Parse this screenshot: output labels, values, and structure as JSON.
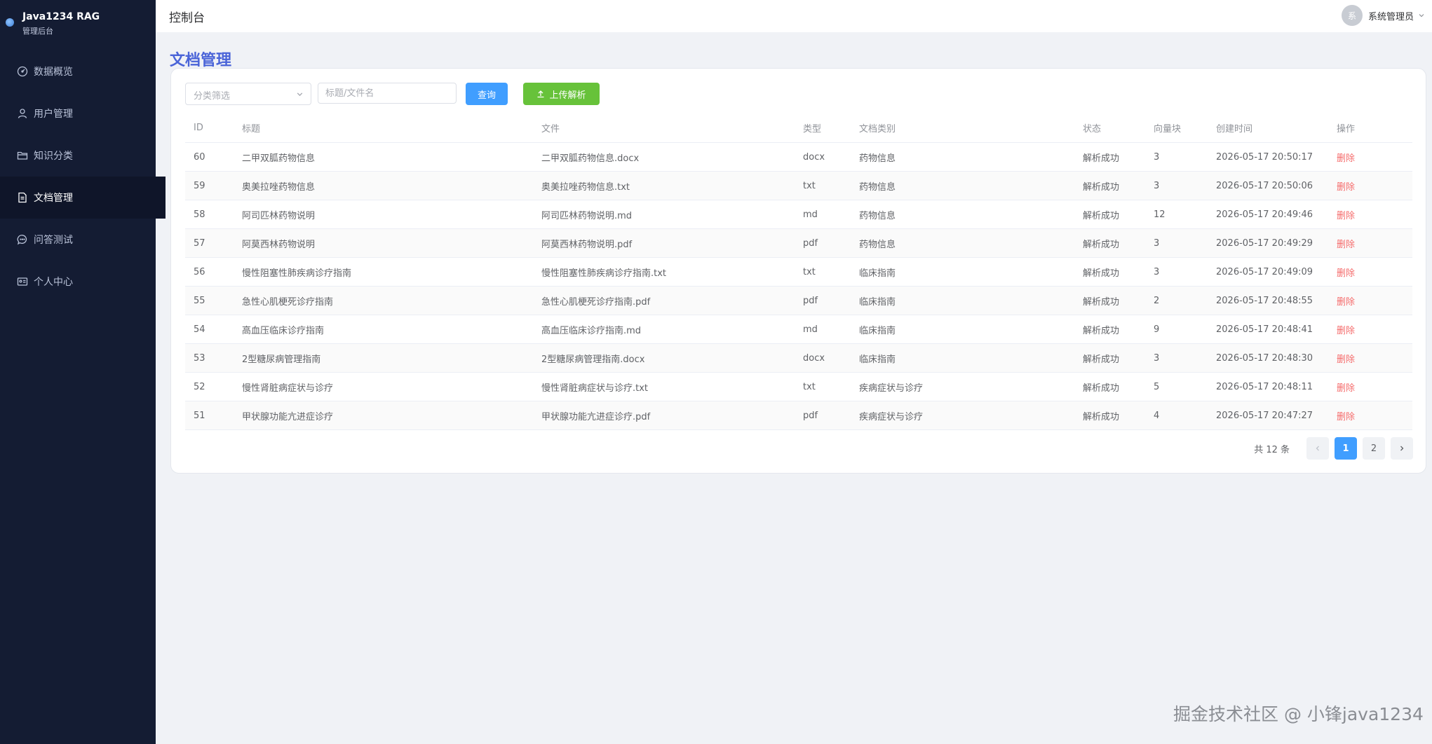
{
  "brand": {
    "title": "Java1234 RAG",
    "subtitle": "管理后台"
  },
  "sidebar": {
    "items": [
      {
        "label": "数据概览",
        "icon": "dashboard-icon"
      },
      {
        "label": "用户管理",
        "icon": "user-icon"
      },
      {
        "label": "知识分类",
        "icon": "folder-icon"
      },
      {
        "label": "文档管理",
        "icon": "document-icon",
        "active": true
      },
      {
        "label": "问答测试",
        "icon": "chat-icon"
      },
      {
        "label": "个人中心",
        "icon": "profile-card-icon"
      }
    ]
  },
  "header": {
    "title": "控制台",
    "avatar_text": "系",
    "user_name": "系统管理员"
  },
  "page": {
    "title": "文档管理"
  },
  "filters": {
    "category_placeholder": "分类筛选",
    "search_placeholder": "标题/文件名",
    "search_value": "",
    "query_label": "查询",
    "upload_label": "上传解析"
  },
  "table": {
    "columns": {
      "id": "ID",
      "title": "标题",
      "file": "文件",
      "type": "类型",
      "category": "文档类别",
      "status": "状态",
      "vectors": "向量块",
      "created": "创建时间",
      "op": "操作"
    },
    "rows": [
      {
        "id": "60",
        "title": "二甲双胍药物信息",
        "file": "二甲双胍药物信息.docx",
        "type": "docx",
        "category": "药物信息",
        "status": "解析成功",
        "vectors": "3",
        "created": "2026-05-17 20:50:17",
        "op": "删除"
      },
      {
        "id": "59",
        "title": "奥美拉唑药物信息",
        "file": "奥美拉唑药物信息.txt",
        "type": "txt",
        "category": "药物信息",
        "status": "解析成功",
        "vectors": "3",
        "created": "2026-05-17 20:50:06",
        "op": "删除"
      },
      {
        "id": "58",
        "title": "阿司匹林药物说明",
        "file": "阿司匹林药物说明.md",
        "type": "md",
        "category": "药物信息",
        "status": "解析成功",
        "vectors": "12",
        "created": "2026-05-17 20:49:46",
        "op": "删除"
      },
      {
        "id": "57",
        "title": "阿莫西林药物说明",
        "file": "阿莫西林药物说明.pdf",
        "type": "pdf",
        "category": "药物信息",
        "status": "解析成功",
        "vectors": "3",
        "created": "2026-05-17 20:49:29",
        "op": "删除"
      },
      {
        "id": "56",
        "title": "慢性阻塞性肺疾病诊疗指南",
        "file": "慢性阻塞性肺疾病诊疗指南.txt",
        "type": "txt",
        "category": "临床指南",
        "status": "解析成功",
        "vectors": "3",
        "created": "2026-05-17 20:49:09",
        "op": "删除"
      },
      {
        "id": "55",
        "title": "急性心肌梗死诊疗指南",
        "file": "急性心肌梗死诊疗指南.pdf",
        "type": "pdf",
        "category": "临床指南",
        "status": "解析成功",
        "vectors": "2",
        "created": "2026-05-17 20:48:55",
        "op": "删除"
      },
      {
        "id": "54",
        "title": "高血压临床诊疗指南",
        "file": "高血压临床诊疗指南.md",
        "type": "md",
        "category": "临床指南",
        "status": "解析成功",
        "vectors": "9",
        "created": "2026-05-17 20:48:41",
        "op": "删除"
      },
      {
        "id": "53",
        "title": "2型糖尿病管理指南",
        "file": "2型糖尿病管理指南.docx",
        "type": "docx",
        "category": "临床指南",
        "status": "解析成功",
        "vectors": "3",
        "created": "2026-05-17 20:48:30",
        "op": "删除"
      },
      {
        "id": "52",
        "title": "慢性肾脏病症状与诊疗",
        "file": "慢性肾脏病症状与诊疗.txt",
        "type": "txt",
        "category": "疾病症状与诊疗",
        "status": "解析成功",
        "vectors": "5",
        "created": "2026-05-17 20:48:11",
        "op": "删除"
      },
      {
        "id": "51",
        "title": "甲状腺功能亢进症诊疗",
        "file": "甲状腺功能亢进症诊疗.pdf",
        "type": "pdf",
        "category": "疾病症状与诊疗",
        "status": "解析成功",
        "vectors": "4",
        "created": "2026-05-17 20:47:27",
        "op": "删除"
      }
    ]
  },
  "pagination": {
    "total_text": "共 12 条",
    "pages": [
      "1",
      "2"
    ],
    "current": "1"
  },
  "watermark": "掘金技术社区 @ 小锋java1234",
  "colors": {
    "sidebar_bg": "#141c33",
    "accent": "#409eff",
    "upload": "#67c23a",
    "danger": "#f56c6c",
    "page_title": "#4a64d8"
  }
}
